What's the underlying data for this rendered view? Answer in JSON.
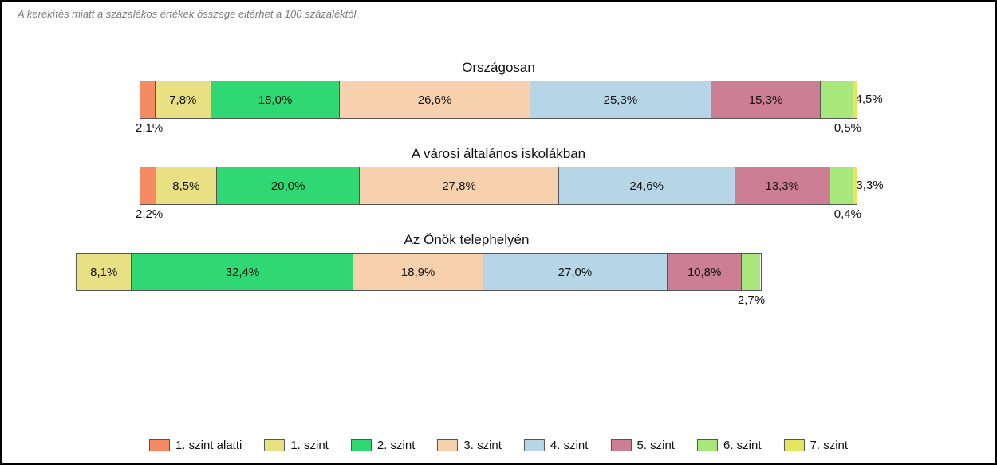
{
  "footnote": "A kerekítés miatt a százalékos értékek összege eltérhet a 100 százaléktól.",
  "colors": {
    "c0": "#f58a63",
    "c1": "#e9e084",
    "c2": "#2fd872",
    "c3": "#f7d1ae",
    "c4": "#b6d6e7",
    "c5": "#cc7e94",
    "c6": "#a7e77c",
    "c7": "#e4e65f"
  },
  "legend": [
    "1. szint alatti",
    "1. szint",
    "2. szint",
    "3. szint",
    "4. szint",
    "5. szint",
    "6. szint",
    "7. szint"
  ],
  "chart_data": {
    "type": "bar",
    "stacked": true,
    "orientation": "horizontal",
    "unit": "percent",
    "categories": [
      "Országosan",
      "A városi általános iskolákban",
      "Az Önök telephelyén"
    ],
    "series": [
      {
        "name": "1. szint alatti",
        "values": [
          2.1,
          2.2,
          0.0
        ]
      },
      {
        "name": "1. szint",
        "values": [
          7.8,
          8.5,
          8.1
        ]
      },
      {
        "name": "2. szint",
        "values": [
          18.0,
          20.0,
          32.4
        ]
      },
      {
        "name": "3. szint",
        "values": [
          26.6,
          27.8,
          18.9
        ]
      },
      {
        "name": "4. szint",
        "values": [
          25.3,
          24.6,
          27.0
        ]
      },
      {
        "name": "5. szint",
        "values": [
          15.3,
          13.3,
          10.8
        ]
      },
      {
        "name": "6. szint",
        "values": [
          4.5,
          3.3,
          2.7
        ]
      },
      {
        "name": "7. szint",
        "values": [
          0.5,
          0.4,
          0.0
        ]
      }
    ]
  },
  "labels": {
    "row0": {
      "val0": "2,1%",
      "val1": "7,8%",
      "val2": "18,0%",
      "val3": "26,6%",
      "val4": "25,3%",
      "val5": "15,3%",
      "val6": "4,5%",
      "val7": "0,5%"
    },
    "row1": {
      "val0": "2,2%",
      "val1": "8,5%",
      "val2": "20,0%",
      "val3": "27,8%",
      "val4": "24,6%",
      "val5": "13,3%",
      "val6": "3,3%",
      "val7": "0,4%"
    },
    "row2": {
      "val1": "8,1%",
      "val2": "32,4%",
      "val3": "18,9%",
      "val4": "27,0%",
      "val5": "10,8%",
      "val6": "2,7%"
    }
  }
}
